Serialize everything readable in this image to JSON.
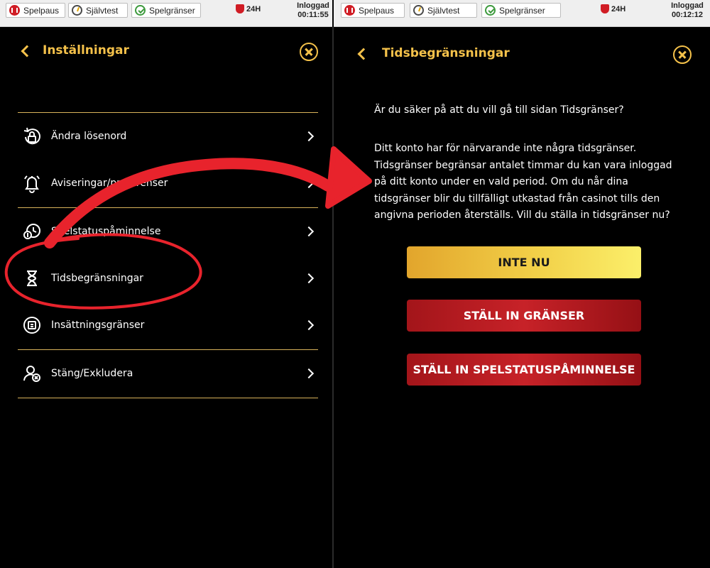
{
  "colors": {
    "gold": "#f4c14a",
    "red_button": "#b81c22",
    "yellow_button": "#f2d048",
    "annotation": "#e8232c"
  },
  "topbar_left": {
    "pause_label": "Spelpaus",
    "selftest_label": "Självtest",
    "limits_label": "Spelgränser",
    "badge_24h": "24H",
    "status": "Inloggad",
    "time": "00:11:55"
  },
  "topbar_right": {
    "pause_label": "Spelpaus",
    "selftest_label": "Självtest",
    "limits_label": "Spelgränser",
    "badge_24h": "24H",
    "status": "Inloggad",
    "time": "00:12:12"
  },
  "settings": {
    "title": "Inställningar",
    "items": [
      {
        "label": "Ändra lösenord",
        "icon": "lock-refresh-icon"
      },
      {
        "label": "Aviseringar/preferenser",
        "icon": "bell-icon"
      },
      {
        "label": "Spelstatuspåminnelse",
        "icon": "clock-coin-icon"
      },
      {
        "label": "Tidsbegränsningar",
        "icon": "hourglass-icon"
      },
      {
        "label": "Insättningsgränser",
        "icon": "deposit-limit-icon"
      },
      {
        "label": "Stäng/Exkludera",
        "icon": "user-exclude-icon"
      }
    ]
  },
  "time_limits": {
    "title": "Tidsbegränsningar",
    "question": "Är du säker på att du vill gå till sidan Tidsgränser?",
    "description": "Ditt konto har för närvarande inte några tidsgränser. Tidsgränser begränsar antalet timmar du kan vara inloggad på ditt konto under en vald period. Om du når dina tidsgränser blir du tillfälligt utkastad från casinot tills den angivna perioden återställs. Vill du ställa in tidsgränser nu?",
    "btn_not_now": "INTE NU",
    "btn_set_limits": "STÄLL IN GRÄNSER",
    "btn_set_reminder": "STÄLL IN SPELSTATUSPÅMINNELSE"
  }
}
